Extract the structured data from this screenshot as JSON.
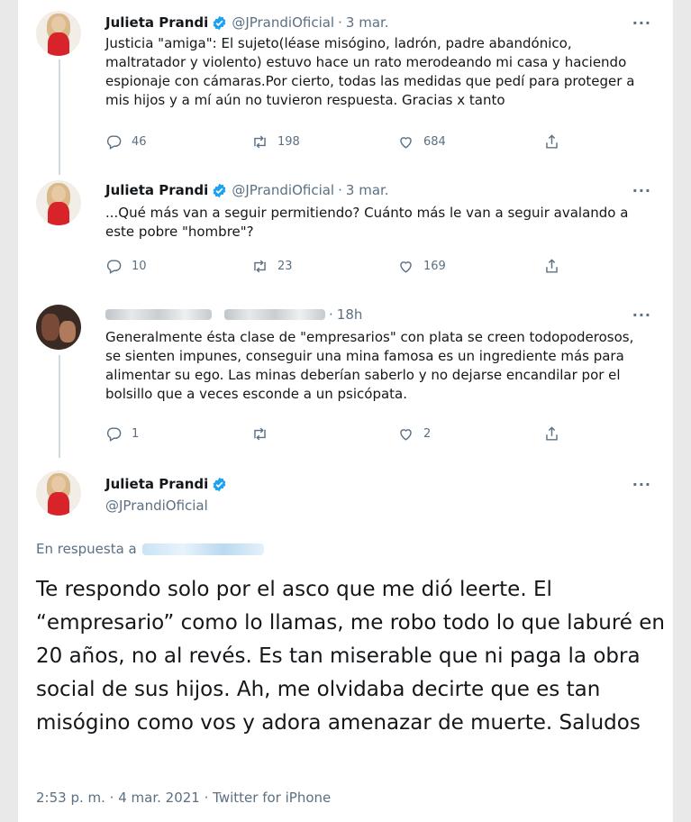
{
  "tweets": [
    {
      "name": "Julieta Prandi",
      "handle": "@JPrandiOficial",
      "date": "3 mar.",
      "text": "Justicia \"amiga\": El sujeto(léase misógino, ladrón, padre abandónico, maltratador y violento) estuvo hace un rato merodeando mi casa y haciendo espionaje con cámaras.Por cierto, todas las medidas que pedí para proteger a mis hijos y a mí aún no tuvieron respuesta. Gracias x tanto",
      "replies": "46",
      "retweets": "198",
      "likes": "684"
    },
    {
      "name": "Julieta Prandi",
      "handle": "@JPrandiOficial",
      "date": "3 mar.",
      "text": "...Qué más van a seguir permitiendo? Cuánto más le van a seguir avalando a este pobre \"hombre\"?",
      "replies": "10",
      "retweets": "23",
      "likes": "169"
    },
    {
      "date": "18h",
      "text": "Generalmente ésta clase de \"empresarios\" con plata se creen todopoderosos, se sienten impunes, conseguir una mina famosa es un ingrediente más para alimentar su ego.  Las minas deberían saberlo y no dejarse encandilar por el bolsillo  que a veces esconde a un psicópata.",
      "replies": "1",
      "retweets": "",
      "likes": "2"
    }
  ],
  "main_tweet": {
    "name": "Julieta Prandi",
    "handle": "@JPrandiOficial",
    "reply_prefix": "En respuesta a",
    "text": "Te respondo solo por el asco que me dió leerte. El “empresario” como lo llamas, me robo todo lo que laburé en 20 años, no al revés. Es tan miserable que ni paga la obra social de sus hijos. Ah, me olvidaba decirte que es tan misógino como vos y adora amenazar de muerte. Saludos",
    "time": "2:53 p. m.",
    "date": "4 mar. 2021",
    "source": "Twitter for iPhone"
  },
  "colors": {
    "verified": "#1da1f2",
    "secondary": "#5b7083",
    "primary_text": "#14171a"
  },
  "icons": [
    "reply-icon",
    "retweet-icon",
    "like-icon",
    "share-icon",
    "verified-icon",
    "more-icon"
  ]
}
